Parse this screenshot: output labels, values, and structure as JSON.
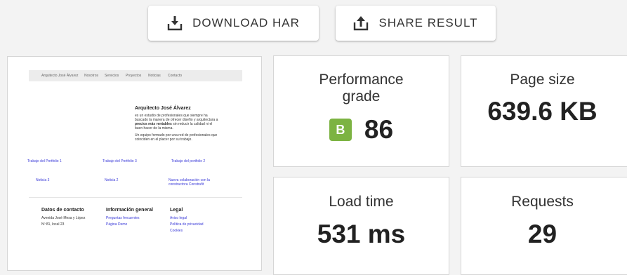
{
  "toolbar": {
    "download_label": "DOWNLOAD HAR",
    "share_label": "SHARE RESULT"
  },
  "metrics": {
    "performance": {
      "label_line1": "Performance",
      "label_line2": "grade",
      "grade": "B",
      "score": "86",
      "grade_color": "#7cb342"
    },
    "page_size": {
      "label": "Page size",
      "value": "639.6 KB"
    },
    "load_time": {
      "label": "Load time",
      "value": "531 ms"
    },
    "requests": {
      "label": "Requests",
      "value": "29"
    }
  },
  "preview": {
    "nav": {
      "brand": "Arquitecto José Álvarez",
      "items": [
        "Nosotros",
        "Servicios",
        "Proyectos",
        "Noticias",
        "Contacto"
      ]
    },
    "hero": {
      "title": "Arquitecto José Álvarez",
      "line1": "es un estudio de profesionales que siempre ha",
      "line2": "buscado la manera de ofrecer diseño y arquitectura a",
      "line3_bold": "precios más rentables",
      "line3_rest": " sin reducir la calidad ni el",
      "line4": "buen hacer de la misma.",
      "line5": "Un equipo formado por una red de profesionales que",
      "line6": "coinciden en el placer por su trabajo."
    },
    "portfolio": [
      "Trabajo del Portfolio 1",
      "Trabajo del Portfolio 3",
      "Trabajo del portfolio 2"
    ],
    "news": [
      "Noticia 3",
      "Noticia 2",
      "Nueva colaboración con la",
      "constructora Construfit"
    ],
    "footer": {
      "contact_title": "Datos de contacto",
      "contact_line1": "Avenida José Mesa y López",
      "contact_line2": "Nº 81, local 23",
      "info_title": "Información general",
      "info_links": [
        "Preguntas frecuentes",
        "Página Demo"
      ],
      "legal_title": "Legal",
      "legal_links": [
        "Aviso legal",
        "Política de privacidad",
        "Cookies"
      ]
    }
  }
}
